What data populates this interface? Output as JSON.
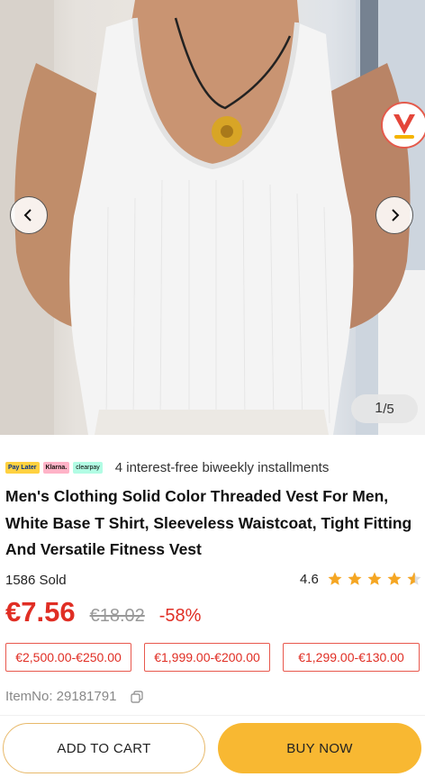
{
  "gallery": {
    "counter_current": "1",
    "counter_total": "/5",
    "prev_icon": "chevron-left-icon",
    "next_icon": "chevron-right-icon",
    "sticker_icon": "brand-sticker-icon"
  },
  "installments": {
    "providers": [
      "Pay Later",
      "Klarna.",
      "clearpay"
    ],
    "text": "4 interest-free biweekly installments"
  },
  "product": {
    "title": "Men's Clothing Solid Color Threaded Vest For Men, White Base T Shirt, Sleeveless Waistcoat, Tight Fitting And Versatile Fitness Vest",
    "sold": "1586 Sold",
    "rating": "4.6",
    "rating_value": 4.6,
    "price": "€7.56",
    "old_price": "€18.02",
    "discount": "-58%",
    "item_no": "ItemNo: 29181791"
  },
  "coupons": [
    "€2,500.00-€250.00",
    "€1,999.00-€200.00",
    "€1,299.00-€130.00"
  ],
  "actions": {
    "add_to_cart": "ADD TO CART",
    "buy_now": "BUY NOW"
  },
  "colors": {
    "accent_red": "#e02e24",
    "buy_now_bg": "#f8b832",
    "star": "#f5a623"
  }
}
